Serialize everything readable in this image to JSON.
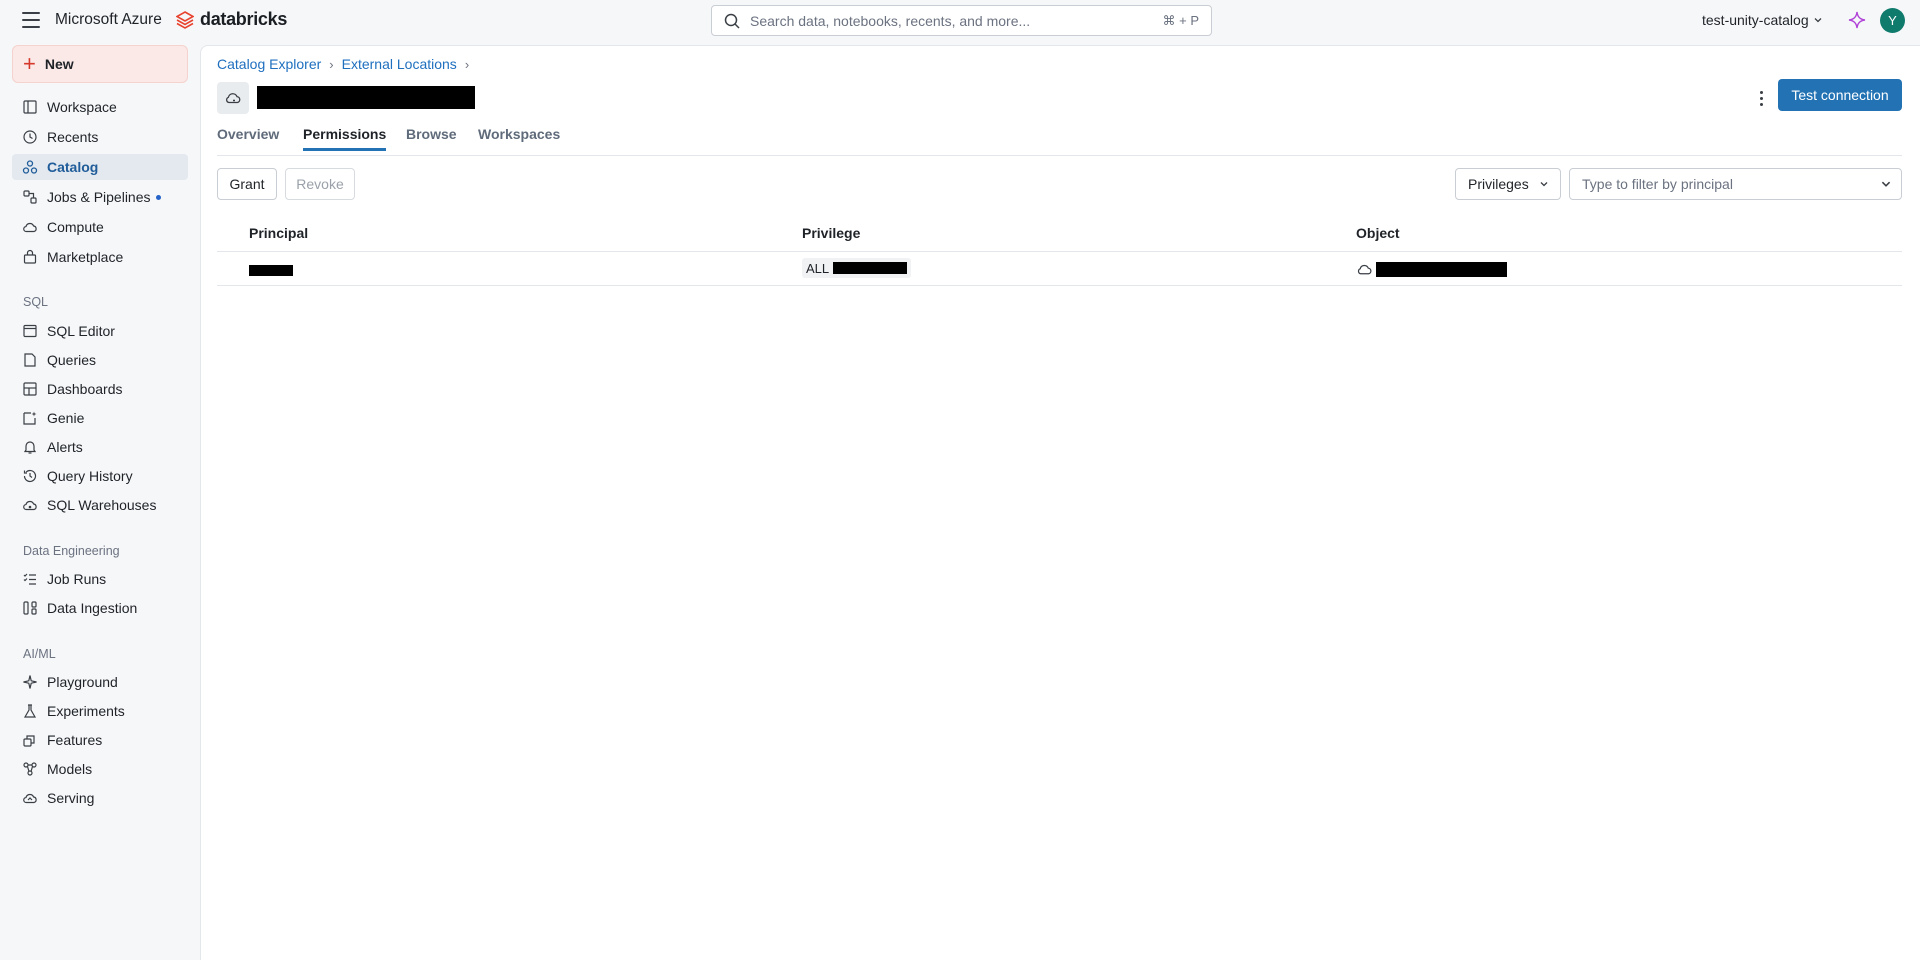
{
  "topbar": {
    "brand_microsoft": "Microsoft Azure",
    "brand_databricks": "databricks",
    "search_placeholder": "Search data, notebooks, recents, and more...",
    "search_shortcut": "⌘ + P",
    "workspace": "test-unity-catalog",
    "avatar_initial": "Y",
    "accent_color": "#2272b4",
    "avatar_color": "#0f7b6c"
  },
  "sidebar": {
    "new_label": "New",
    "items": [
      {
        "label": "Workspace",
        "icon": "workspace-icon"
      },
      {
        "label": "Recents",
        "icon": "clock-icon"
      },
      {
        "label": "Catalog",
        "icon": "catalog-icon",
        "active": true
      },
      {
        "label": "Jobs & Pipelines",
        "icon": "jobs-icon",
        "has_dot": true
      },
      {
        "label": "Compute",
        "icon": "cloud-icon"
      },
      {
        "label": "Marketplace",
        "icon": "marketplace-icon"
      }
    ],
    "sql_section": "SQL",
    "sql_items": [
      {
        "label": "SQL Editor",
        "icon": "sql-editor-icon"
      },
      {
        "label": "Queries",
        "icon": "queries-icon"
      },
      {
        "label": "Dashboards",
        "icon": "dashboards-icon"
      },
      {
        "label": "Genie",
        "icon": "genie-icon"
      },
      {
        "label": "Alerts",
        "icon": "bell-icon"
      },
      {
        "label": "Query History",
        "icon": "history-icon"
      },
      {
        "label": "SQL Warehouses",
        "icon": "warehouse-icon"
      }
    ],
    "de_section": "Data Engineering",
    "de_items": [
      {
        "label": "Job Runs",
        "icon": "job-runs-icon"
      },
      {
        "label": "Data Ingestion",
        "icon": "ingestion-icon"
      }
    ],
    "ml_section": "AI/ML",
    "ml_items": [
      {
        "label": "Playground",
        "icon": "playground-icon"
      },
      {
        "label": "Experiments",
        "icon": "experiments-icon"
      },
      {
        "label": "Features",
        "icon": "features-icon"
      },
      {
        "label": "Models",
        "icon": "models-icon"
      },
      {
        "label": "Serving",
        "icon": "serving-icon"
      }
    ]
  },
  "main": {
    "breadcrumb": [
      "Catalog Explorer",
      "External Locations"
    ],
    "test_connection": "Test connection",
    "tabs": [
      "Overview",
      "Permissions",
      "Browse",
      "Workspaces"
    ],
    "active_tab": "Permissions",
    "grant": "Grant",
    "revoke": "Revoke",
    "privileges_filter": "Privileges",
    "principal_filter_placeholder": "Type to filter by principal",
    "table": {
      "columns": [
        "Principal",
        "Privilege",
        "Object"
      ],
      "rows": [
        {
          "privilege_prefix": "ALL"
        }
      ]
    }
  }
}
